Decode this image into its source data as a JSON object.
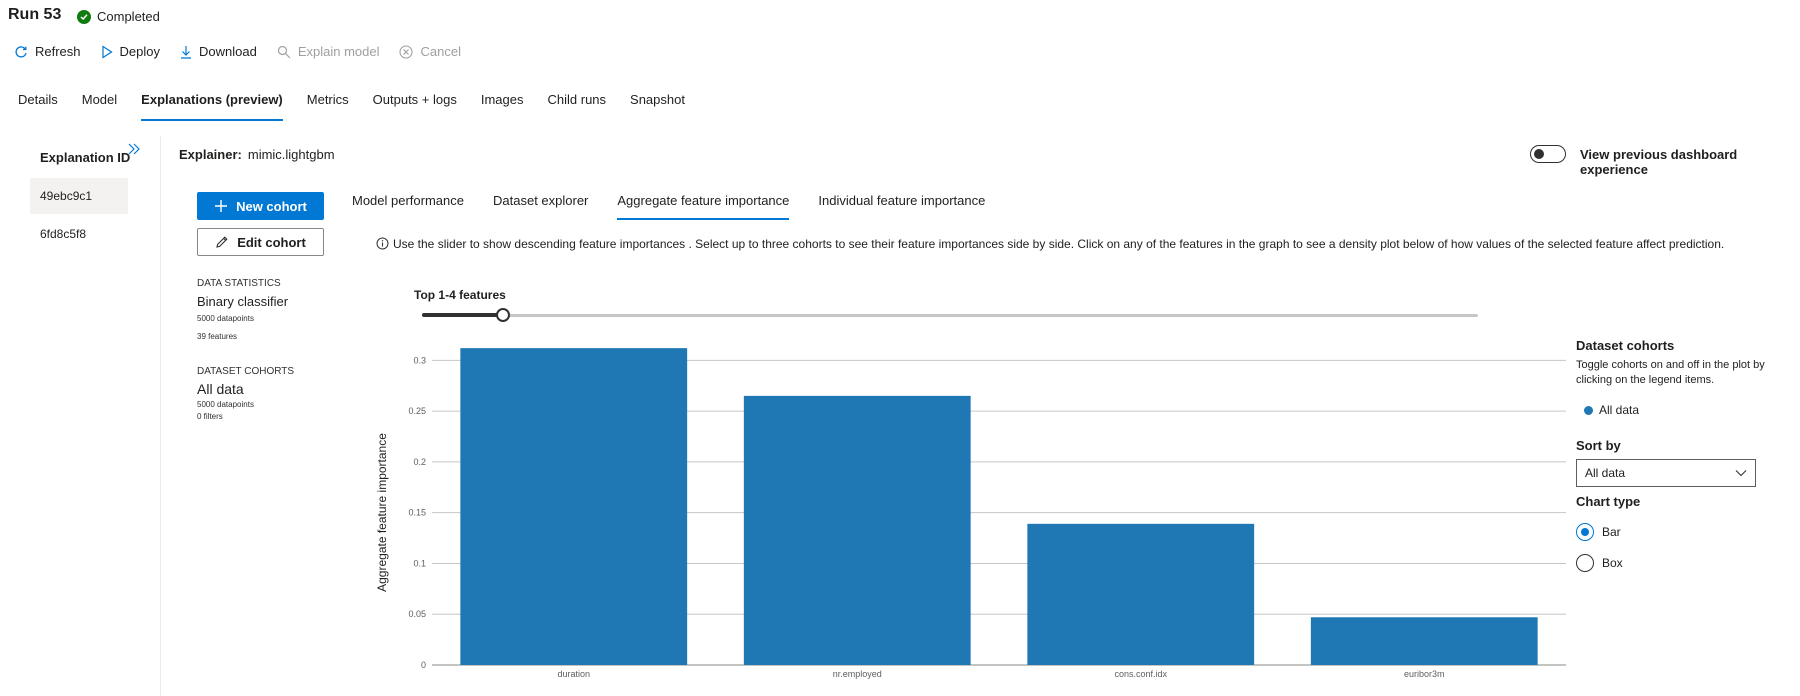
{
  "header": {
    "title": "Run 53",
    "status": "Completed"
  },
  "toolbar": {
    "refresh": "Refresh",
    "deploy": "Deploy",
    "download": "Download",
    "explain_model": "Explain model",
    "cancel": "Cancel"
  },
  "tabs": [
    "Details",
    "Model",
    "Explanations (preview)",
    "Metrics",
    "Outputs + logs",
    "Images",
    "Child runs",
    "Snapshot"
  ],
  "active_tab": "Explanations (preview)",
  "explanations": {
    "header": "Explanation ID",
    "items": [
      "49ebc9c1",
      "6fd8c5f8"
    ],
    "selected": "49ebc9c1"
  },
  "explainer": {
    "label": "Explainer:",
    "value": "mimic.lightgbm"
  },
  "toggle": {
    "label": "View previous dashboard experience",
    "on": false
  },
  "cohort_buttons": {
    "new": "New cohort",
    "edit": "Edit cohort"
  },
  "data_statistics": {
    "heading": "DATA STATISTICS",
    "type": "Binary classifier",
    "datapoints": "5000 datapoints",
    "features": "39 features"
  },
  "dataset_cohorts": {
    "heading": "DATASET COHORTS",
    "name": "All data",
    "datapoints": "5000 datapoints",
    "filters": "0 filters"
  },
  "subtabs": [
    "Model performance",
    "Dataset explorer",
    "Aggregate feature importance",
    "Individual feature importance"
  ],
  "active_subtab": "Aggregate feature importance",
  "info": "Use the slider to show descending feature importances . Select up to three cohorts to see their feature importances side by side. Click on any of the features in the graph to see a density plot below of how values of the selected feature affect prediction.",
  "slider": {
    "label": "Top 1-4 features",
    "value": 4
  },
  "legend_panel": {
    "title": "Dataset cohorts",
    "description": "Toggle cohorts on and off in the plot by clicking on the legend items.",
    "items": [
      "All data"
    ],
    "sort_label": "Sort by",
    "sort_value": "All data",
    "chart_type_label": "Chart type",
    "chart_types": [
      "Bar",
      "Box"
    ],
    "chart_type_selected": "Bar"
  },
  "colors": {
    "accent": "#0078d4",
    "bar": "#1f77b4",
    "success": "#107c10"
  },
  "chart_data": {
    "type": "bar",
    "categories": [
      "duration",
      "nr.employed",
      "cons.conf.idx",
      "euribor3m"
    ],
    "series": [
      {
        "name": "All data",
        "values": [
          0.312,
          0.265,
          0.139,
          0.047
        ]
      }
    ],
    "ylabel": "Aggregate feature importance",
    "xlabel": "",
    "ylim": [
      0,
      0.32
    ],
    "yticks": [
      "0",
      "0.05",
      "0.1",
      "0.15",
      "0.2",
      "0.25",
      "0.3"
    ],
    "grid": true
  }
}
